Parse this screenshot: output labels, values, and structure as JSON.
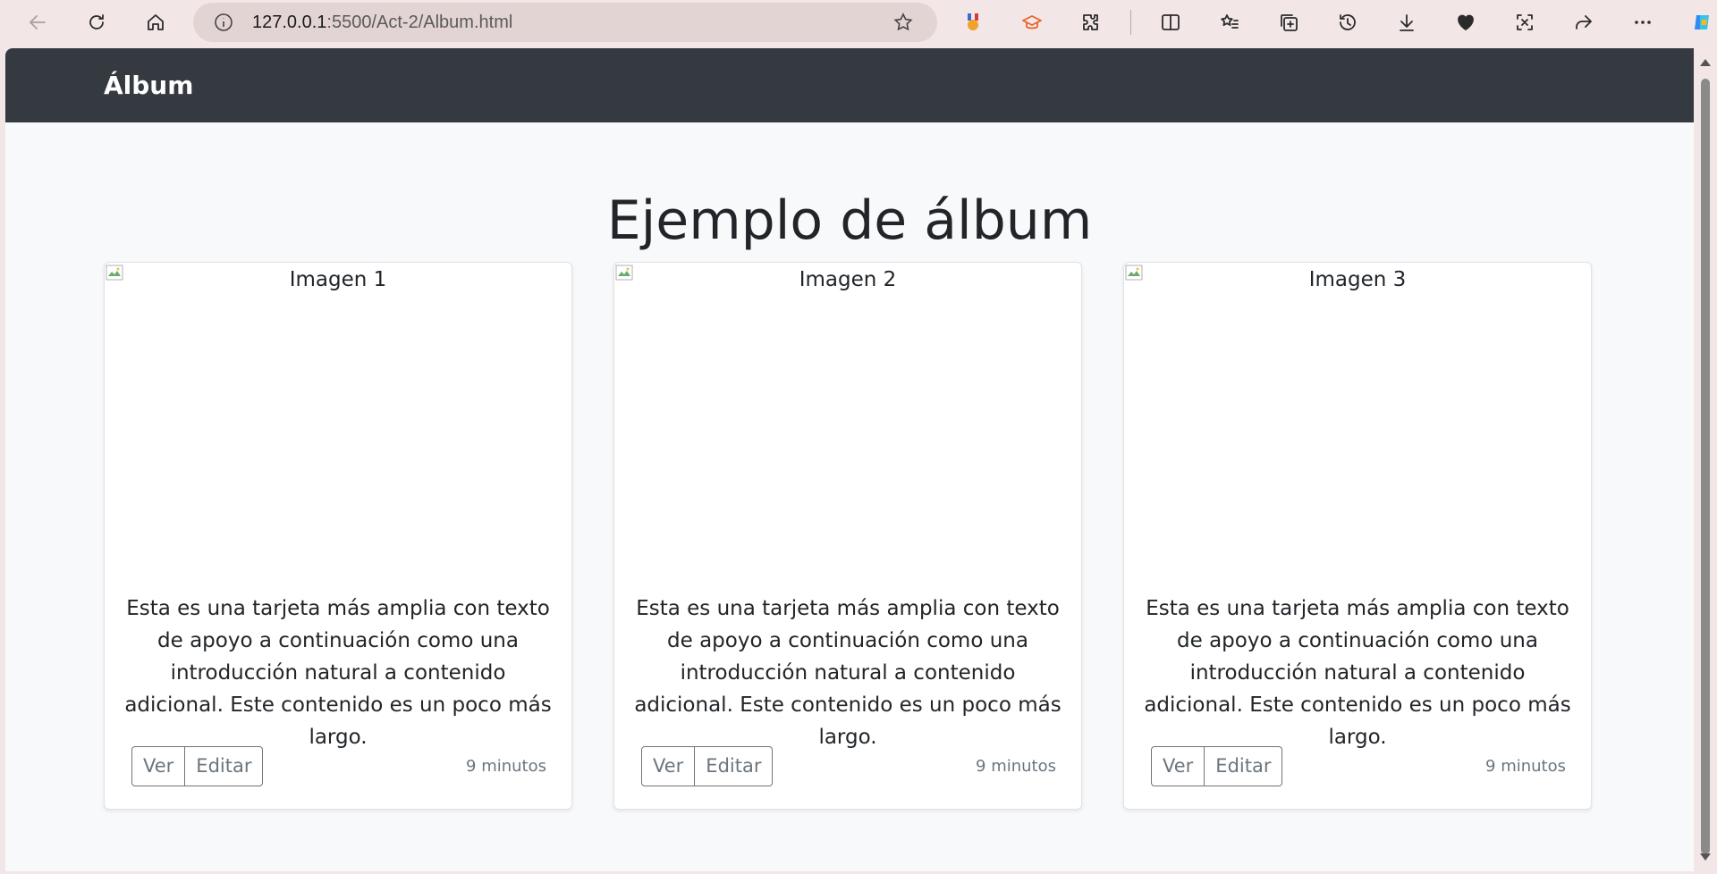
{
  "browser": {
    "url_host": "127.0.0.1",
    "url_path": ":5500/Act-2/Album.html"
  },
  "navbar": {
    "brand": "Álbum"
  },
  "page": {
    "title": "Ejemplo de álbum"
  },
  "cards": [
    {
      "image_alt": "Imagen 1",
      "text": "Esta es una tarjeta más amplia con texto de apoyo a continuación como una introducción natural a contenido adicional. Este contenido es un poco más largo.",
      "view_label": "Ver",
      "edit_label": "Editar",
      "time": "9 minutos"
    },
    {
      "image_alt": "Imagen 2",
      "text": "Esta es una tarjeta más amplia con texto de apoyo a continuación como una introducción natural a contenido adicional. Este contenido es un poco más largo.",
      "view_label": "Ver",
      "edit_label": "Editar",
      "time": "9 minutos"
    },
    {
      "image_alt": "Imagen 3",
      "text": "Esta es una tarjeta más amplia con texto de apoyo a continuación como una introducción natural a contenido adicional. Este contenido es un poco más largo.",
      "view_label": "Ver",
      "edit_label": "Editar",
      "time": "9 minutos"
    }
  ]
}
